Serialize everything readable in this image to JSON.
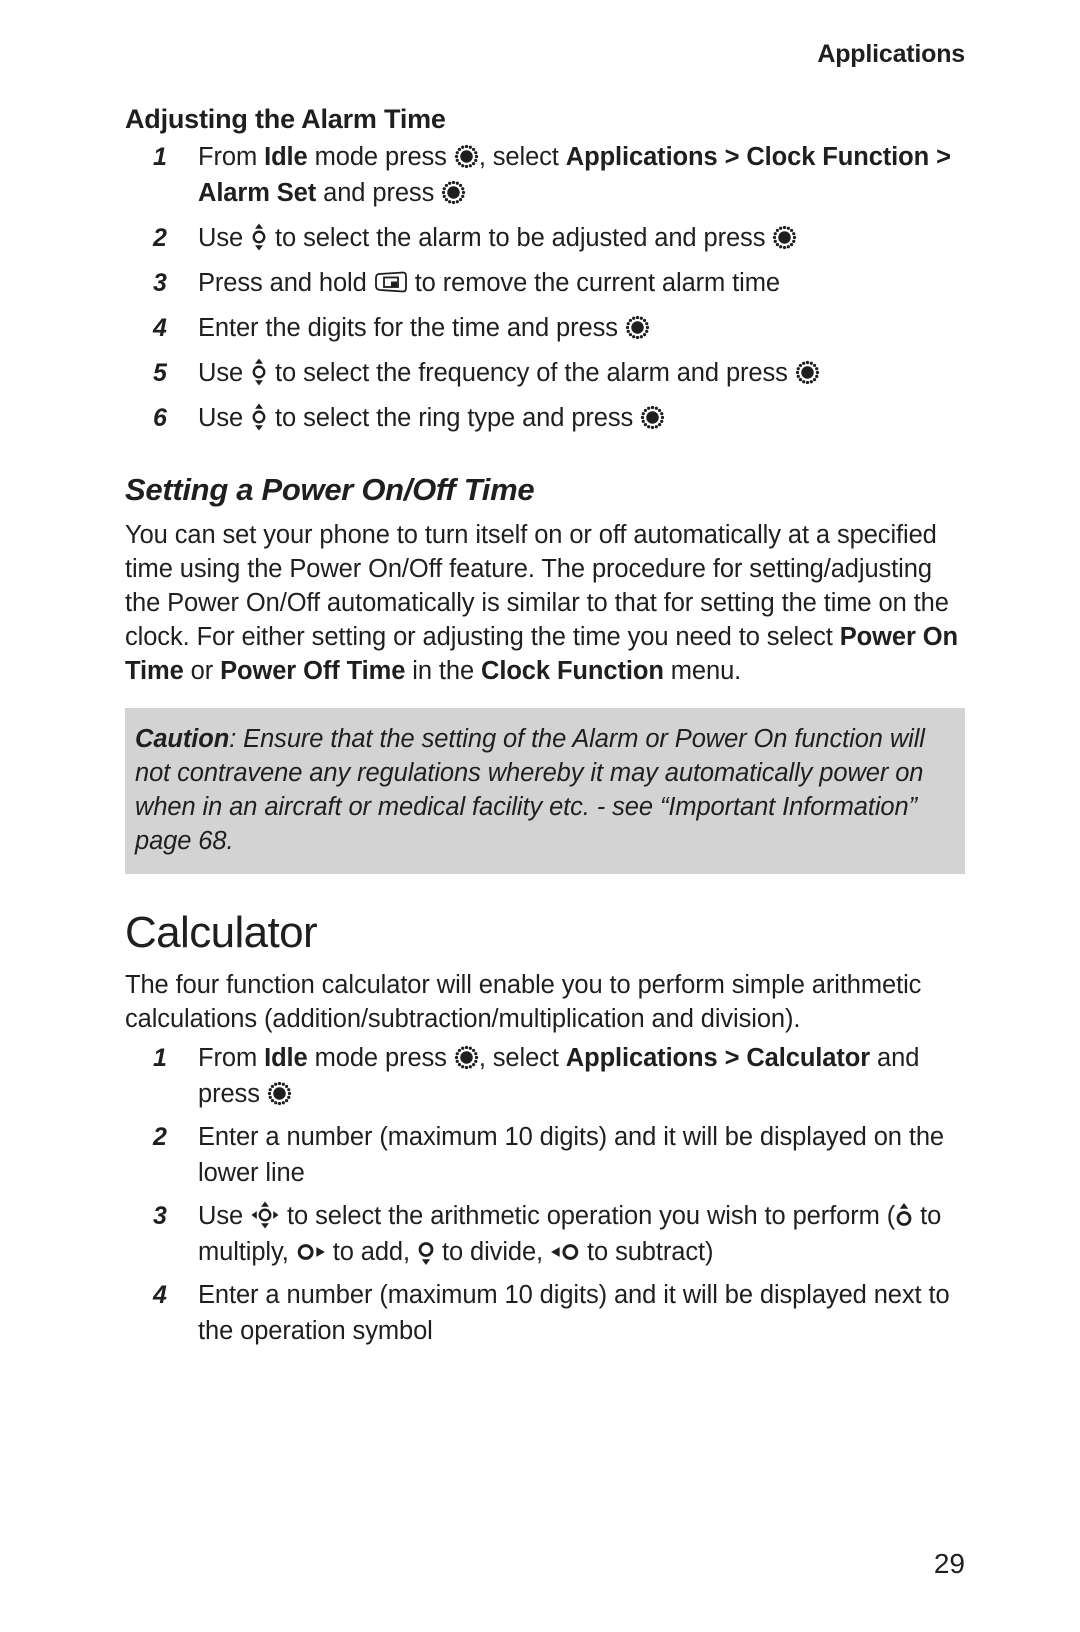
{
  "header": {
    "running_head": "Applications"
  },
  "sections": {
    "alarm": {
      "heading": "Adjusting the Alarm Time",
      "steps": [
        {
          "number": "1",
          "parts": [
            {
              "t": "From ",
              "b": false
            },
            {
              "t": "Idle",
              "b": true
            },
            {
              "t": " mode press ",
              "b": false
            },
            {
              "icon": "select-key-icon"
            },
            {
              "t": ", select ",
              "b": false
            },
            {
              "t": "Applications > Clock Function > Alarm Set",
              "b": true
            },
            {
              "t": " and press ",
              "b": false
            },
            {
              "icon": "select-key-icon"
            }
          ]
        },
        {
          "number": "2",
          "parts": [
            {
              "t": "Use ",
              "b": false
            },
            {
              "icon": "nav-up-down-key-icon"
            },
            {
              "t": " to select the alarm to be adjusted and press ",
              "b": false
            },
            {
              "icon": "select-key-icon"
            }
          ]
        },
        {
          "number": "3",
          "parts": [
            {
              "t": "Press and hold ",
              "b": false
            },
            {
              "icon": "clear-key-icon"
            },
            {
              "t": " to remove the current alarm time",
              "b": false
            }
          ]
        },
        {
          "number": "4",
          "parts": [
            {
              "t": "Enter the digits for the time and press ",
              "b": false
            },
            {
              "icon": "select-key-icon"
            }
          ]
        },
        {
          "number": "5",
          "parts": [
            {
              "t": "Use ",
              "b": false
            },
            {
              "icon": "nav-up-down-key-icon"
            },
            {
              "t": " to select the frequency of the alarm and press ",
              "b": false
            },
            {
              "icon": "select-key-icon"
            }
          ]
        },
        {
          "number": "6",
          "parts": [
            {
              "t": "Use ",
              "b": false
            },
            {
              "icon": "nav-up-down-key-icon"
            },
            {
              "t": " to select the ring type and press ",
              "b": false
            },
            {
              "icon": "select-key-icon"
            }
          ]
        }
      ]
    },
    "power_on_off": {
      "heading": "Setting a Power On/Off Time",
      "paragraph_parts": [
        {
          "t": "You can set your phone to turn itself on or off automatically at a specified time using the Power On/Off feature. The procedure for setting/adjusting the Power On/Off automatically is similar to that for setting the time on the clock. For either setting or adjusting the time you need to select ",
          "b": false
        },
        {
          "t": "Power On Time",
          "b": true
        },
        {
          "t": " or ",
          "b": false
        },
        {
          "t": "Power Off Time",
          "b": true
        },
        {
          "t": " in the ",
          "b": false
        },
        {
          "t": "Clock Function",
          "b": true
        },
        {
          "t": " menu.",
          "b": false
        }
      ],
      "caution": {
        "label": "Caution",
        "text": ": Ensure that the setting of the Alarm or Power On function will not contravene any regulations whereby it may automatically power on when in an aircraft or medical facility etc. - see “Important Information” page 68.",
        "background_color": "#d3d3d3"
      }
    },
    "calculator": {
      "heading": "Calculator",
      "paragraph": "The four function calculator will enable you to perform simple arithmetic calculations (addition/subtraction/multiplication and division).",
      "steps": [
        {
          "number": "1",
          "parts": [
            {
              "t": "From ",
              "b": false
            },
            {
              "t": "Idle",
              "b": true
            },
            {
              "t": " mode press ",
              "b": false
            },
            {
              "icon": "select-key-icon"
            },
            {
              "t": ", select ",
              "b": false
            },
            {
              "t": "Applications > Calculator",
              "b": true
            },
            {
              "t": " and press ",
              "b": false
            },
            {
              "icon": "select-key-icon"
            }
          ]
        },
        {
          "number": "2",
          "parts": [
            {
              "t": "Enter a number (maximum 10 digits) and it will be displayed on the lower line",
              "b": false
            }
          ]
        },
        {
          "number": "3",
          "parts": [
            {
              "t": "Use ",
              "b": false
            },
            {
              "icon": "nav-four-way-key-icon"
            },
            {
              "t": " to select the arithmetic operation you wish to perform (",
              "b": false
            },
            {
              "icon": "nav-up-key-icon"
            },
            {
              "t": " to multiply, ",
              "b": false
            },
            {
              "icon": "nav-right-key-icon"
            },
            {
              "t": " to add, ",
              "b": false
            },
            {
              "icon": "nav-down-key-icon"
            },
            {
              "t": " to divide, ",
              "b": false
            },
            {
              "icon": "nav-left-key-icon"
            },
            {
              "t": " to subtract)",
              "b": false
            }
          ]
        },
        {
          "number": "4",
          "parts": [
            {
              "t": "Enter a number (maximum 10 digits) and it will be displayed next to the operation symbol",
              "b": false
            }
          ]
        }
      ]
    }
  },
  "footer": {
    "page_number": "29"
  },
  "colors": {
    "text": "#201f1f",
    "caution_background": "#d3d3d3",
    "page_background": "#ffffff"
  }
}
